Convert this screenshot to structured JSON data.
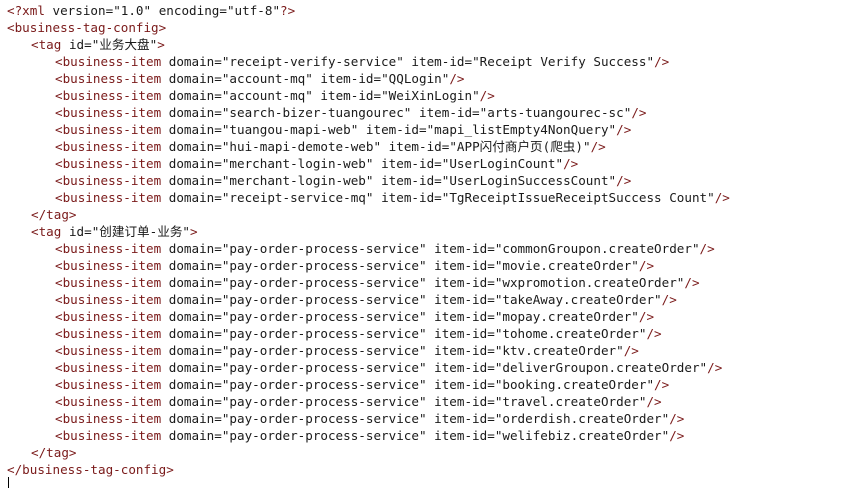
{
  "xml_decl": {
    "open": "<?",
    "name": "xml",
    "version_attr": "version=",
    "version_val": "\"1.0\"",
    "encoding_attr": "encoding=",
    "encoding_val": "\"utf-8\"",
    "close": "?>"
  },
  "root": {
    "open": "<business-tag-config>",
    "close": "</business-tag-config>"
  },
  "tag_open_prefix": "<tag",
  "tag_close": "</tag>",
  "id_attr": "id=",
  "item_prefix": "<business-item",
  "domain_attr": "domain=",
  "item_id_attr": "item-id=",
  "self_close": "/>",
  "gt": ">",
  "tags": [
    {
      "id": "\"业务大盘\"",
      "items": [
        {
          "domain": "\"receipt-verify-service\"",
          "item_id": "\"Receipt Verify Success\""
        },
        {
          "domain": "\"account-mq\"",
          "item_id": "\"QQLogin\""
        },
        {
          "domain": "\"account-mq\"",
          "item_id": "\"WeiXinLogin\""
        },
        {
          "domain": "\"search-bizer-tuangourec\"",
          "item_id": "\"arts-tuangourec-sc\""
        },
        {
          "domain": "\"tuangou-mapi-web\"",
          "item_id": "\"mapi_listEmpty4NonQuery\""
        },
        {
          "domain": "\"hui-mapi-demote-web\"",
          "item_id": "\"APP闪付商户页(爬虫)\""
        },
        {
          "domain": "\"merchant-login-web\"",
          "item_id": "\"UserLoginCount\""
        },
        {
          "domain": "\"merchant-login-web\"",
          "item_id": "\"UserLoginSuccessCount\""
        },
        {
          "domain": "\"receipt-service-mq\"",
          "item_id": "\"TgReceiptIssueReceiptSuccess Count\""
        }
      ]
    },
    {
      "id": "\"创建订单-业务\"",
      "items": [
        {
          "domain": "\"pay-order-process-service\"",
          "item_id": "\"commonGroupon.createOrder\""
        },
        {
          "domain": "\"pay-order-process-service\"",
          "item_id": "\"movie.createOrder\""
        },
        {
          "domain": "\"pay-order-process-service\"",
          "item_id": "\"wxpromotion.createOrder\""
        },
        {
          "domain": "\"pay-order-process-service\"",
          "item_id": "\"takeAway.createOrder\""
        },
        {
          "domain": "\"pay-order-process-service\"",
          "item_id": "\"mopay.createOrder\""
        },
        {
          "domain": "\"pay-order-process-service\"",
          "item_id": "\"tohome.createOrder\""
        },
        {
          "domain": "\"pay-order-process-service\"",
          "item_id": "\"ktv.createOrder\""
        },
        {
          "domain": "\"pay-order-process-service\"",
          "item_id": "\"deliverGroupon.createOrder\""
        },
        {
          "domain": "\"pay-order-process-service\"",
          "item_id": "\"booking.createOrder\""
        },
        {
          "domain": "\"pay-order-process-service\"",
          "item_id": "\"travel.createOrder\""
        },
        {
          "domain": "\"pay-order-process-service\"",
          "item_id": "\"orderdish.createOrder\""
        },
        {
          "domain": "\"pay-order-process-service\"",
          "item_id": "\"welifebiz.createOrder\""
        }
      ]
    }
  ],
  "colors": {
    "tag": "#7a1a1a",
    "text": "#1a1a1a",
    "background": "#ffffff"
  }
}
